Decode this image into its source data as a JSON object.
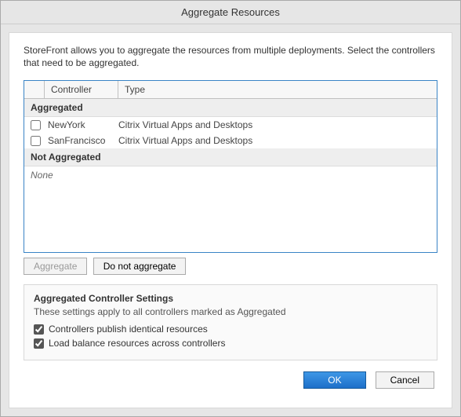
{
  "window": {
    "title": "Aggregate Resources"
  },
  "intro": "StoreFront allows you to aggregate the resources from multiple deployments. Select the controllers that need to be aggregated.",
  "table": {
    "headers": {
      "controller": "Controller",
      "type": "Type"
    },
    "aggregated_label": "Aggregated",
    "not_aggregated_label": "Not Aggregated",
    "none_label": "None",
    "aggregated": [
      {
        "checked": false,
        "controller": "NewYork",
        "type": "Citrix Virtual Apps and Desktops"
      },
      {
        "checked": false,
        "controller": "SanFrancisco",
        "type": "Citrix Virtual Apps and Desktops"
      }
    ],
    "not_aggregated": []
  },
  "buttons": {
    "aggregate": "Aggregate",
    "do_not_aggregate": "Do not aggregate"
  },
  "settings": {
    "title": "Aggregated Controller Settings",
    "desc": "These settings apply to all controllers marked as Aggregated",
    "opt1_label": "Controllers publish identical resources",
    "opt1_checked": true,
    "opt2_label": "Load balance resources across controllers",
    "opt2_checked": true
  },
  "footer": {
    "ok": "OK",
    "cancel": "Cancel"
  }
}
